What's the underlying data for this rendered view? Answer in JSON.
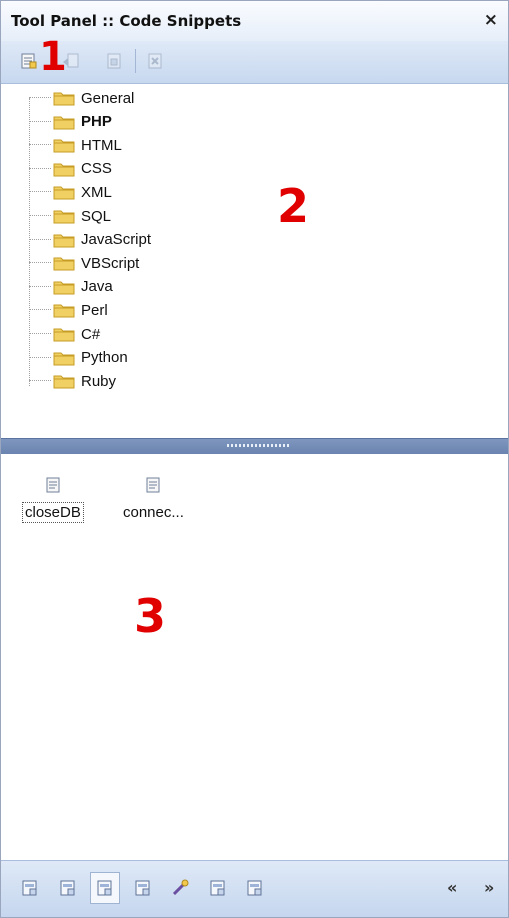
{
  "window": {
    "title": "Tool Panel :: Code Snippets",
    "close_label": "×"
  },
  "toolbar": {
    "buttons": [
      {
        "name": "new-snippet-button",
        "icon": "new-snippet-icon",
        "enabled": true
      },
      {
        "name": "edit-snippet-button",
        "icon": "edit-snippet-icon",
        "enabled": false
      },
      {
        "name": "insert-snippet-button",
        "icon": "insert-snippet-icon",
        "enabled": false
      },
      {
        "name": "delete-snippet-button",
        "icon": "delete-snippet-icon",
        "enabled": false
      }
    ]
  },
  "annotations": {
    "a1": "1",
    "a2": "2",
    "a3": "3",
    "color": "#e00000"
  },
  "tree": {
    "items": [
      {
        "label": "General",
        "bold": false
      },
      {
        "label": "PHP",
        "bold": true
      },
      {
        "label": "HTML",
        "bold": false
      },
      {
        "label": "CSS",
        "bold": false
      },
      {
        "label": "XML",
        "bold": false
      },
      {
        "label": "SQL",
        "bold": false
      },
      {
        "label": "JavaScript",
        "bold": false
      },
      {
        "label": "VBScript",
        "bold": false
      },
      {
        "label": "Java",
        "bold": false
      },
      {
        "label": "Perl",
        "bold": false
      },
      {
        "label": "C#",
        "bold": false
      },
      {
        "label": "Python",
        "bold": false
      },
      {
        "label": "Ruby",
        "bold": false
      }
    ]
  },
  "snippets": [
    {
      "label": "closeDB",
      "focused": true
    },
    {
      "label": "connec...",
      "focused": false
    }
  ],
  "statusbar": {
    "buttons": [
      "panel-1-icon",
      "panel-2-icon",
      "code-snippets-icon",
      "panel-4-icon",
      "wand-icon",
      "panel-6-icon",
      "panel-7-icon"
    ],
    "active_index": 2,
    "prev_label": "«",
    "next_label": "»"
  },
  "colors": {
    "folder": "#f0cf63",
    "folder_dark": "#c79c25",
    "splitter": "#6a84b0"
  }
}
